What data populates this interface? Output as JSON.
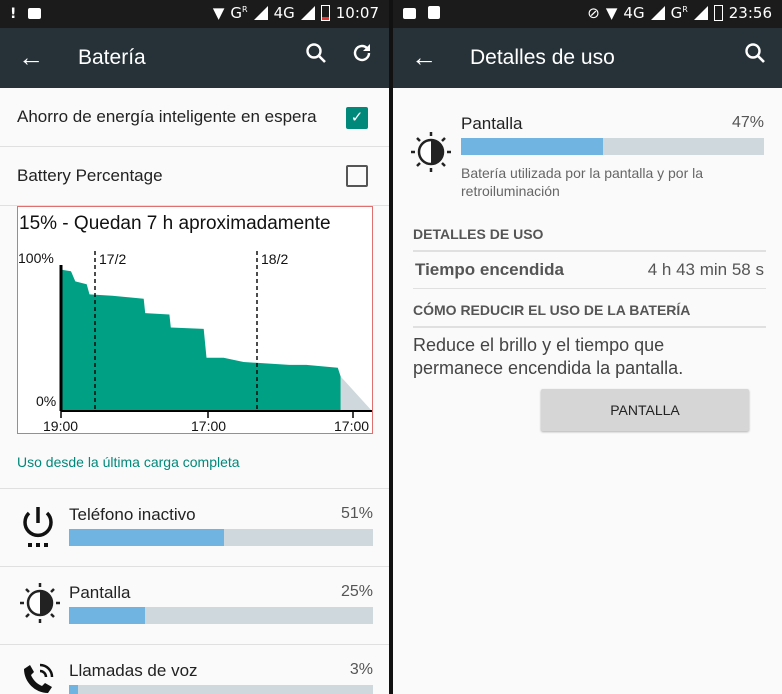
{
  "left": {
    "status": {
      "time": "10:07",
      "network": "4G",
      "carrier_label": "G",
      "roaming": "R"
    },
    "appbar": {
      "title": "Batería"
    },
    "settings": [
      {
        "label": "Ahorro de energía inteligente en espera",
        "checked": true
      },
      {
        "label": "Battery Percentage",
        "checked": false
      }
    ],
    "chart_data": {
      "type": "area",
      "title": "15% - Quedan 7 h aproximadamente",
      "y_tick_labels": [
        "100%",
        "0%"
      ],
      "x_tick_labels": [
        "19:00",
        "17:00",
        "17:00"
      ],
      "markers": [
        "17/2",
        "18/2"
      ],
      "ylim": [
        0,
        100
      ],
      "series": [
        {
          "values": [
            [
              0,
              100
            ],
            [
              0.5,
              98
            ],
            [
              3.5,
              97
            ],
            [
              5,
              90
            ],
            [
              9,
              88
            ],
            [
              10,
              81
            ],
            [
              18,
              80
            ],
            [
              29,
              78
            ],
            [
              29.5,
              68
            ],
            [
              38,
              67
            ],
            [
              38.5,
              58
            ],
            [
              50,
              57
            ],
            [
              51,
              37
            ],
            [
              57,
              37
            ],
            [
              64,
              34
            ],
            [
              80,
              32
            ],
            [
              86,
              32
            ],
            [
              97,
              30
            ],
            [
              98,
              24
            ]
          ]
        }
      ],
      "projection": [
        [
          98,
          24
        ],
        [
          109,
          0
        ]
      ],
      "xlim": [
        0,
        109
      ],
      "colors": {
        "fill": "#00a085",
        "projection": "#cfd8dc"
      }
    },
    "usage_link": "Uso desde la última carga completa",
    "usage": [
      {
        "name": "Teléfono inactivo",
        "pct_label": "51%",
        "pct": 51,
        "icon": "power-icon"
      },
      {
        "name": "Pantalla",
        "pct_label": "25%",
        "pct": 25,
        "icon": "brightness-icon"
      },
      {
        "name": "Llamadas de voz",
        "pct_label": "3%",
        "pct": 3,
        "icon": "phone-call-icon"
      }
    ]
  },
  "right": {
    "status": {
      "time": "23:56",
      "network": "4G",
      "carrier_label": "G",
      "roaming": "R"
    },
    "appbar": {
      "title": "Detalles de uso"
    },
    "item": {
      "name": "Pantalla",
      "pct_label": "47%",
      "pct": 47,
      "description": "Batería utilizada por la pantalla y por la retroiluminación"
    },
    "details_header": "DETALLES DE USO",
    "time_on_label": "Tiempo encendida",
    "time_on_value": "4 h 43 min 58 s",
    "reduce_header": "CÓMO REDUCIR EL USO DE LA BATERÍA",
    "reduce_text": "Reduce el brillo y el tiempo que permanece encendida la pantalla.",
    "button_label": "PANTALLA"
  },
  "colors": {
    "accent": "#00897b",
    "appbar": "#263238",
    "bar": "#70b4e2",
    "track": "#cfd8dc"
  }
}
